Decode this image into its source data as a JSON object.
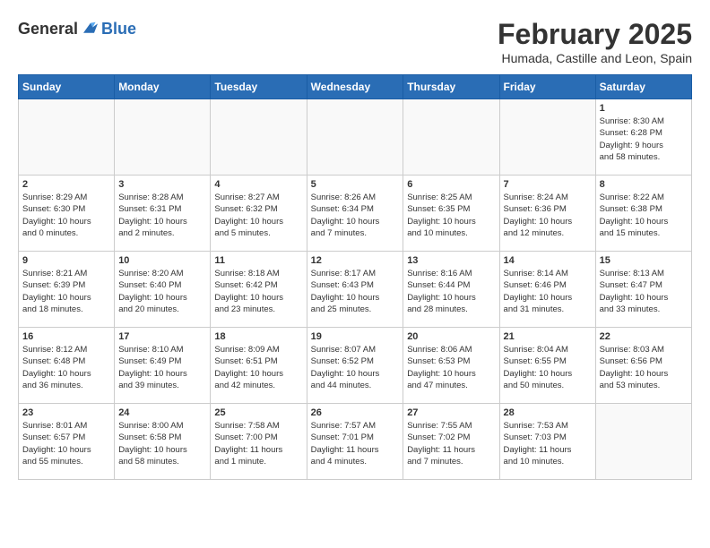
{
  "header": {
    "logo_general": "General",
    "logo_blue": "Blue",
    "month_title": "February 2025",
    "location": "Humada, Castille and Leon, Spain"
  },
  "weekdays": [
    "Sunday",
    "Monday",
    "Tuesday",
    "Wednesday",
    "Thursday",
    "Friday",
    "Saturday"
  ],
  "weeks": [
    [
      {
        "day": "",
        "info": ""
      },
      {
        "day": "",
        "info": ""
      },
      {
        "day": "",
        "info": ""
      },
      {
        "day": "",
        "info": ""
      },
      {
        "day": "",
        "info": ""
      },
      {
        "day": "",
        "info": ""
      },
      {
        "day": "1",
        "info": "Sunrise: 8:30 AM\nSunset: 6:28 PM\nDaylight: 9 hours\nand 58 minutes."
      }
    ],
    [
      {
        "day": "2",
        "info": "Sunrise: 8:29 AM\nSunset: 6:30 PM\nDaylight: 10 hours\nand 0 minutes."
      },
      {
        "day": "3",
        "info": "Sunrise: 8:28 AM\nSunset: 6:31 PM\nDaylight: 10 hours\nand 2 minutes."
      },
      {
        "day": "4",
        "info": "Sunrise: 8:27 AM\nSunset: 6:32 PM\nDaylight: 10 hours\nand 5 minutes."
      },
      {
        "day": "5",
        "info": "Sunrise: 8:26 AM\nSunset: 6:34 PM\nDaylight: 10 hours\nand 7 minutes."
      },
      {
        "day": "6",
        "info": "Sunrise: 8:25 AM\nSunset: 6:35 PM\nDaylight: 10 hours\nand 10 minutes."
      },
      {
        "day": "7",
        "info": "Sunrise: 8:24 AM\nSunset: 6:36 PM\nDaylight: 10 hours\nand 12 minutes."
      },
      {
        "day": "8",
        "info": "Sunrise: 8:22 AM\nSunset: 6:38 PM\nDaylight: 10 hours\nand 15 minutes."
      }
    ],
    [
      {
        "day": "9",
        "info": "Sunrise: 8:21 AM\nSunset: 6:39 PM\nDaylight: 10 hours\nand 18 minutes."
      },
      {
        "day": "10",
        "info": "Sunrise: 8:20 AM\nSunset: 6:40 PM\nDaylight: 10 hours\nand 20 minutes."
      },
      {
        "day": "11",
        "info": "Sunrise: 8:18 AM\nSunset: 6:42 PM\nDaylight: 10 hours\nand 23 minutes."
      },
      {
        "day": "12",
        "info": "Sunrise: 8:17 AM\nSunset: 6:43 PM\nDaylight: 10 hours\nand 25 minutes."
      },
      {
        "day": "13",
        "info": "Sunrise: 8:16 AM\nSunset: 6:44 PM\nDaylight: 10 hours\nand 28 minutes."
      },
      {
        "day": "14",
        "info": "Sunrise: 8:14 AM\nSunset: 6:46 PM\nDaylight: 10 hours\nand 31 minutes."
      },
      {
        "day": "15",
        "info": "Sunrise: 8:13 AM\nSunset: 6:47 PM\nDaylight: 10 hours\nand 33 minutes."
      }
    ],
    [
      {
        "day": "16",
        "info": "Sunrise: 8:12 AM\nSunset: 6:48 PM\nDaylight: 10 hours\nand 36 minutes."
      },
      {
        "day": "17",
        "info": "Sunrise: 8:10 AM\nSunset: 6:49 PM\nDaylight: 10 hours\nand 39 minutes."
      },
      {
        "day": "18",
        "info": "Sunrise: 8:09 AM\nSunset: 6:51 PM\nDaylight: 10 hours\nand 42 minutes."
      },
      {
        "day": "19",
        "info": "Sunrise: 8:07 AM\nSunset: 6:52 PM\nDaylight: 10 hours\nand 44 minutes."
      },
      {
        "day": "20",
        "info": "Sunrise: 8:06 AM\nSunset: 6:53 PM\nDaylight: 10 hours\nand 47 minutes."
      },
      {
        "day": "21",
        "info": "Sunrise: 8:04 AM\nSunset: 6:55 PM\nDaylight: 10 hours\nand 50 minutes."
      },
      {
        "day": "22",
        "info": "Sunrise: 8:03 AM\nSunset: 6:56 PM\nDaylight: 10 hours\nand 53 minutes."
      }
    ],
    [
      {
        "day": "23",
        "info": "Sunrise: 8:01 AM\nSunset: 6:57 PM\nDaylight: 10 hours\nand 55 minutes."
      },
      {
        "day": "24",
        "info": "Sunrise: 8:00 AM\nSunset: 6:58 PM\nDaylight: 10 hours\nand 58 minutes."
      },
      {
        "day": "25",
        "info": "Sunrise: 7:58 AM\nSunset: 7:00 PM\nDaylight: 11 hours\nand 1 minute."
      },
      {
        "day": "26",
        "info": "Sunrise: 7:57 AM\nSunset: 7:01 PM\nDaylight: 11 hours\nand 4 minutes."
      },
      {
        "day": "27",
        "info": "Sunrise: 7:55 AM\nSunset: 7:02 PM\nDaylight: 11 hours\nand 7 minutes."
      },
      {
        "day": "28",
        "info": "Sunrise: 7:53 AM\nSunset: 7:03 PM\nDaylight: 11 hours\nand 10 minutes."
      },
      {
        "day": "",
        "info": ""
      }
    ]
  ]
}
